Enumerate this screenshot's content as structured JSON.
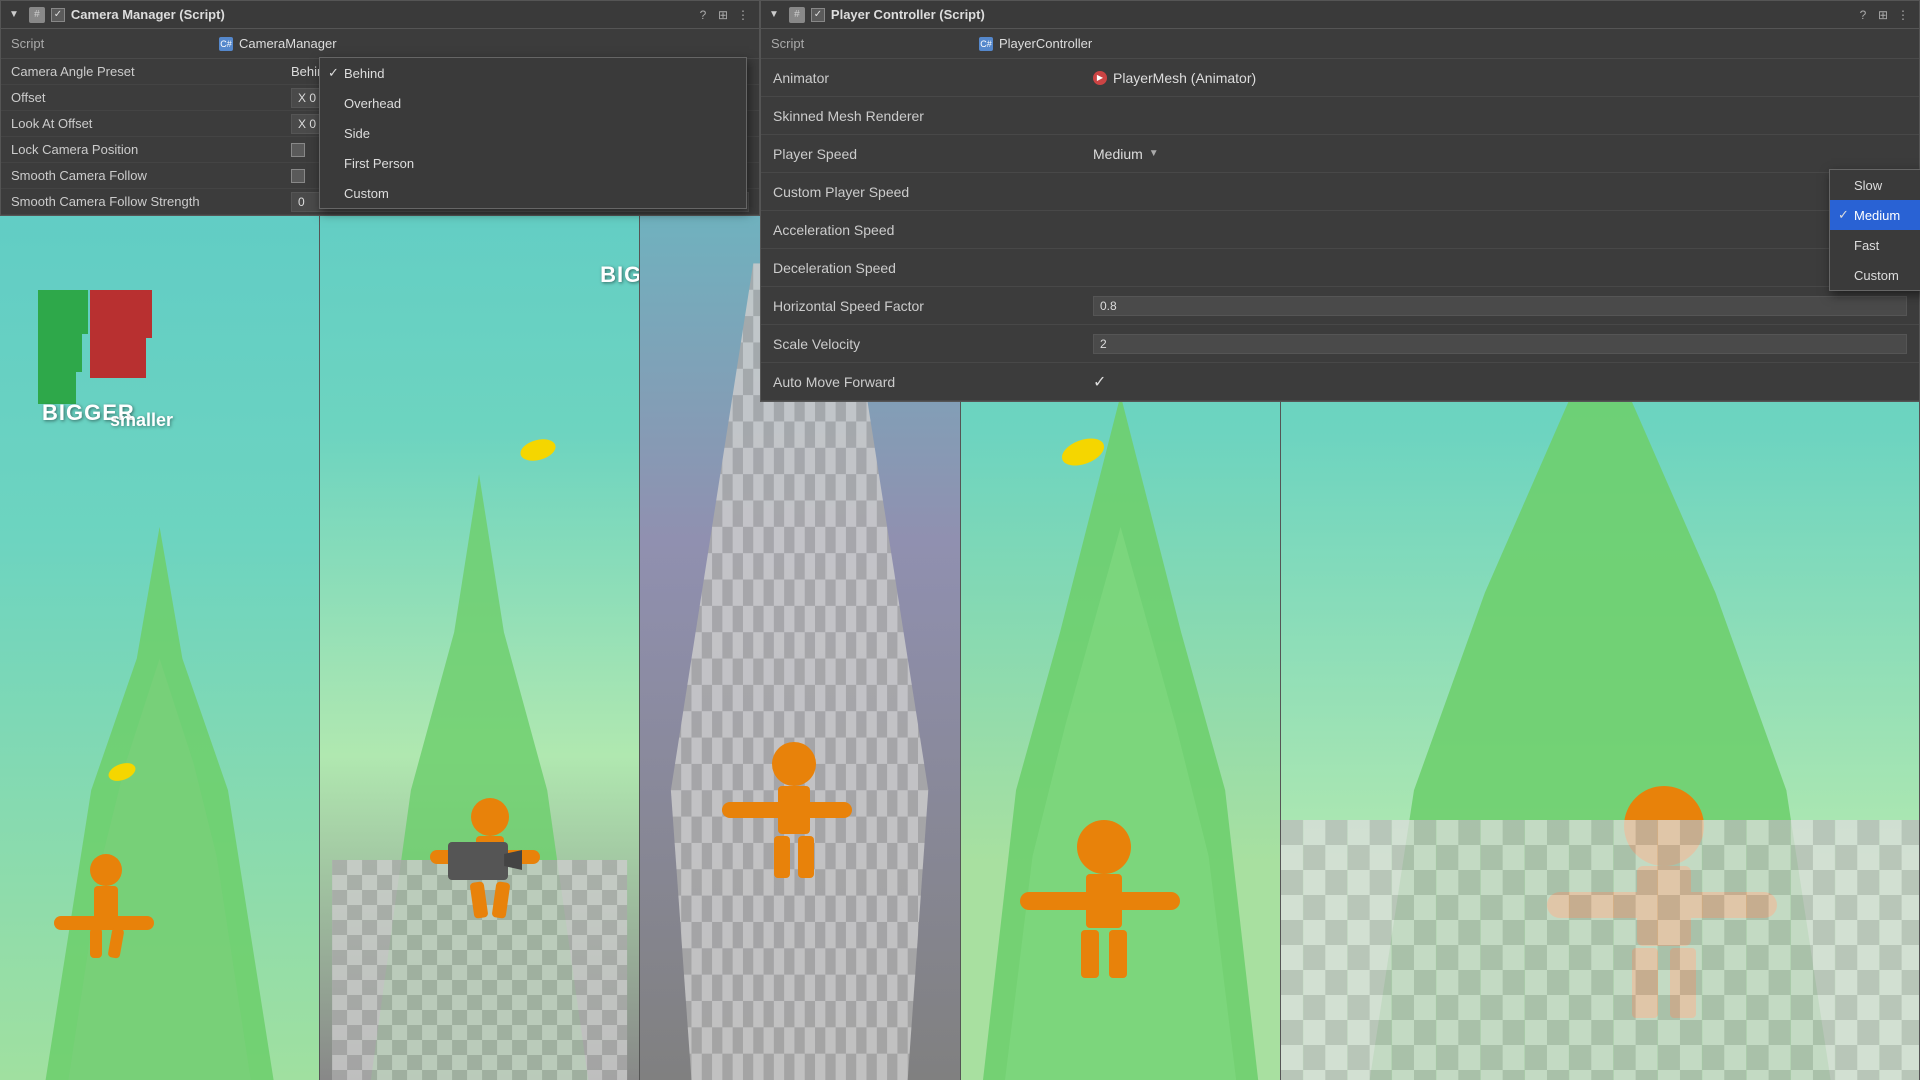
{
  "camera_panel": {
    "title": "Camera Manager (Script)",
    "script_label": "Script",
    "script_value": "CameraManager",
    "properties": [
      {
        "label": "Camera Angle Preset",
        "value": "Behind",
        "type": "dropdown"
      },
      {
        "label": "Offset",
        "value": ""
      },
      {
        "label": "Look At Offset",
        "value": ""
      },
      {
        "label": "Lock Camera Position",
        "value": ""
      },
      {
        "label": "Smooth Camera Follow",
        "value": ""
      },
      {
        "label": "Smooth Camera Follow Strength",
        "value": "0"
      }
    ],
    "dropdown_items": [
      {
        "label": "Behind",
        "selected": true
      },
      {
        "label": "Overhead",
        "selected": false
      },
      {
        "label": "Side",
        "selected": false
      },
      {
        "label": "First Person",
        "selected": false
      },
      {
        "label": "Custom",
        "selected": false
      }
    ]
  },
  "player_panel": {
    "title": "Player Controller (Script)",
    "script_label": "Script",
    "script_value": "PlayerController",
    "animator_label": "Animator",
    "animator_value": "PlayerMesh (Animator)",
    "skinned_label": "Skinned Mesh Renderer",
    "properties": [
      {
        "label": "Player Speed",
        "value": "",
        "type": "dropdown"
      },
      {
        "label": "Custom Player Speed",
        "value": ""
      },
      {
        "label": "Acceleration Speed",
        "value": ""
      },
      {
        "label": "Deceleration Speed",
        "value": ""
      },
      {
        "label": "Horizontal Speed Factor",
        "value": "0.8"
      },
      {
        "label": "Scale Velocity",
        "value": "2"
      },
      {
        "label": "Auto Move Forward",
        "value": "✓",
        "type": "checkbox"
      }
    ],
    "speed_dropdown": [
      {
        "label": "Slow",
        "selected": false
      },
      {
        "label": "Medium",
        "selected": true
      },
      {
        "label": "Fast",
        "selected": false
      },
      {
        "label": "Custom",
        "selected": false
      }
    ]
  },
  "icons": {
    "hash": "#",
    "script_cs": "C#",
    "check": "✓",
    "arrow_right": "▶",
    "settings": "⚙",
    "kebab": "⋮",
    "question": "?",
    "dock": "⊞",
    "collapse": "▼"
  }
}
